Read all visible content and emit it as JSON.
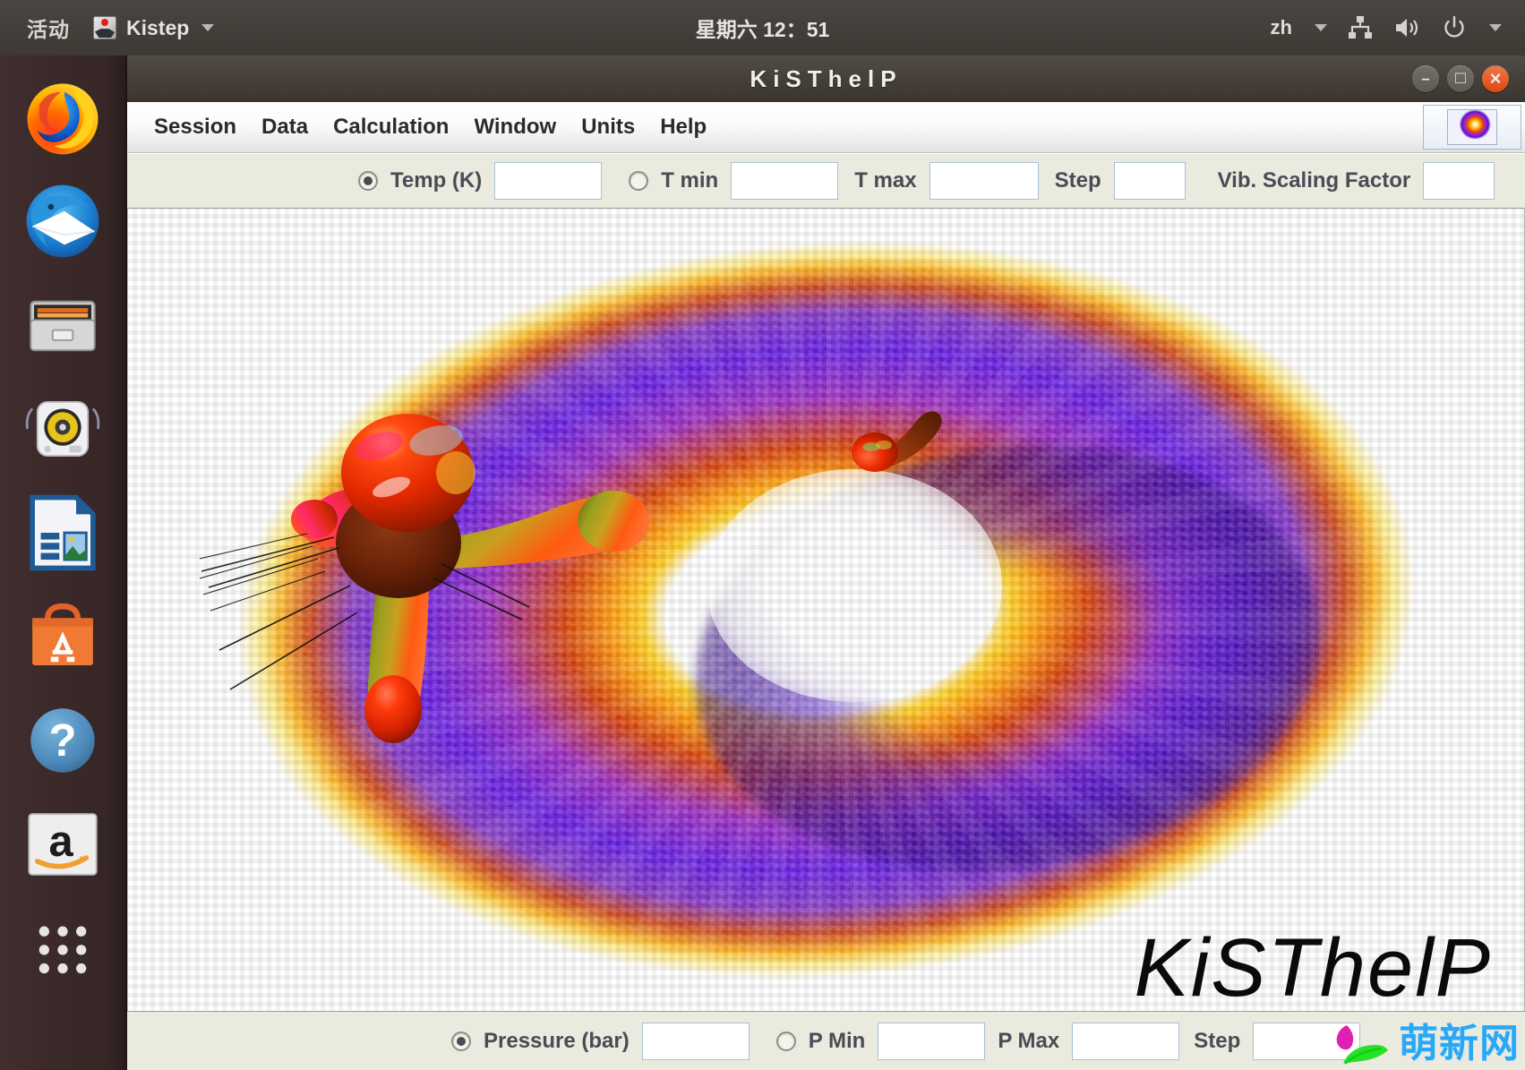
{
  "topbar": {
    "activities": "活动",
    "app_name": "Kistep",
    "app_icon": "kistep-app-icon",
    "clock": "星期六 12：51",
    "language": "zh",
    "icons": {
      "network": "network-icon",
      "volume": "volume-icon",
      "power": "power-icon",
      "menu_caret": "chevron-down-icon"
    }
  },
  "dock": {
    "items": [
      {
        "name": "firefox",
        "label": "Firefox"
      },
      {
        "name": "thunderbird",
        "label": "Thunderbird Mail"
      },
      {
        "name": "files",
        "label": "Files"
      },
      {
        "name": "rhythmbox",
        "label": "Rhythmbox"
      },
      {
        "name": "libreoffice-impress",
        "label": "LibreOffice Impress"
      },
      {
        "name": "ubuntu-software",
        "label": "Ubuntu Software"
      },
      {
        "name": "help",
        "label": "Help"
      },
      {
        "name": "amazon",
        "label": "Amazon"
      },
      {
        "name": "show-applications",
        "label": "Show Applications"
      }
    ]
  },
  "window": {
    "title": "KiSThelP",
    "controls": {
      "minimize": "minimize-button",
      "maximize": "maximize-button",
      "close": "close-button"
    },
    "menu": [
      {
        "label": "Session"
      },
      {
        "label": "Data"
      },
      {
        "label": "Calculation"
      },
      {
        "label": "Window"
      },
      {
        "label": "Units"
      },
      {
        "label": "Help"
      }
    ],
    "toolbar_button": "splash-thumbnail-button"
  },
  "temperature_params": {
    "mode_single_selected": true,
    "mode_range_selected": false,
    "temp_label": "Temp (K)",
    "temp_value": "",
    "tmin_label": "T min",
    "tmin_value": "",
    "tmax_label": "T max",
    "tmax_value": "",
    "step_label": "Step",
    "step_value": "",
    "vib_label": "Vib. Scaling Factor",
    "vib_value": ""
  },
  "pressure_params": {
    "mode_single_selected": true,
    "mode_range_selected": false,
    "pressure_label": "Pressure (bar)",
    "pressure_value": "",
    "pmin_label": "P Min",
    "pmin_value": "",
    "pmax_label": "P Max",
    "pmax_value": "",
    "step_label": "Step",
    "step_value": ""
  },
  "canvas": {
    "splash_logo_text": "KiSThelP",
    "graphic": "molecular-orbital-splash-image"
  },
  "watermark": {
    "text": "萌新网",
    "logo": "leaf-logo-icon"
  },
  "colors": {
    "topbar_bg": "#3d3934",
    "dock_bg": "#3b2a2a",
    "titlebar_bg": "#464039",
    "param_bar_bg": "#eaeade",
    "close_button": "#dd4814",
    "watermark_text": "#29a8f5",
    "label_text": "#4b4b55"
  }
}
